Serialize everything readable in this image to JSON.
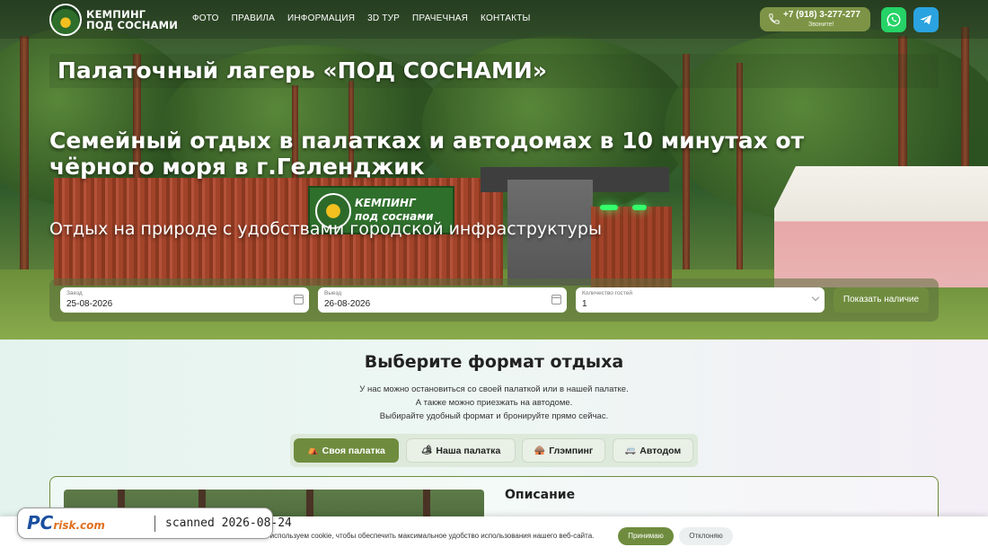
{
  "header": {
    "logo_line1": "КЕМПИНГ",
    "logo_line2": "ПОД СОСНАМИ",
    "nav": [
      "ФОТО",
      "ПРАВИЛА",
      "ИНФОРМАЦИЯ",
      "3D ТУР",
      "ПРАЧЕЧНАЯ",
      "КОНТАКТЫ"
    ],
    "phone": "+7 (918) 3-277-277",
    "phone_caption": "Звоните!",
    "icons": {
      "phone": "phone-icon",
      "whatsapp": "whatsapp-icon",
      "telegram": "telegram-icon"
    }
  },
  "hero": {
    "title": "Палаточный лагерь «ПОД СОСНАМИ»",
    "subtitle": "Семейный отдых в палатках и автодомах в 10 минутах от чёрного моря в г.Геленджик",
    "tagline": "Отдых на природе с удобствами городской инфраструктуры",
    "sign_line1": "КЕМПИНГ",
    "sign_line2": "под соснами"
  },
  "booking": {
    "checkin_label": "Заезд",
    "checkin_value": "25-08-2026",
    "checkout_label": "Выезд",
    "checkout_value": "26-08-2026",
    "guests_label": "Количество гостей",
    "guests_value": "1",
    "submit_label": "Показать наличие"
  },
  "format": {
    "title": "Выберите формат отдыха",
    "lines": [
      "У нас можно остановиться со своей палаткой или в нашей палатке.",
      "А также можно приезжать на автодоме.",
      "Выбирайте удобный формат и бронируйте прямо сейчас."
    ],
    "tabs": [
      {
        "label": "Своя палатка",
        "icon": "⛺",
        "active": true
      },
      {
        "label": "Наша палатка",
        "icon": "🏕",
        "active": false
      },
      {
        "label": "Глэмпинг",
        "icon": "🛖",
        "active": false
      },
      {
        "label": "Автодом",
        "icon": "🚐",
        "active": false
      }
    ],
    "card_title": "Описание"
  },
  "cookie": {
    "text": "Мы используем cookie, чтобы обеспечить максимальное удобство использования нашего веб-сайта.",
    "accept": "Принимаю",
    "decline": "Отклоняю"
  },
  "watermark": {
    "brand_pc": "PC",
    "brand_risk": "risk.com",
    "text": "scanned 2026-08-24"
  },
  "colors": {
    "accent": "#6f8c3e",
    "whatsapp": "#25d366",
    "telegram": "#2aa3e0"
  }
}
